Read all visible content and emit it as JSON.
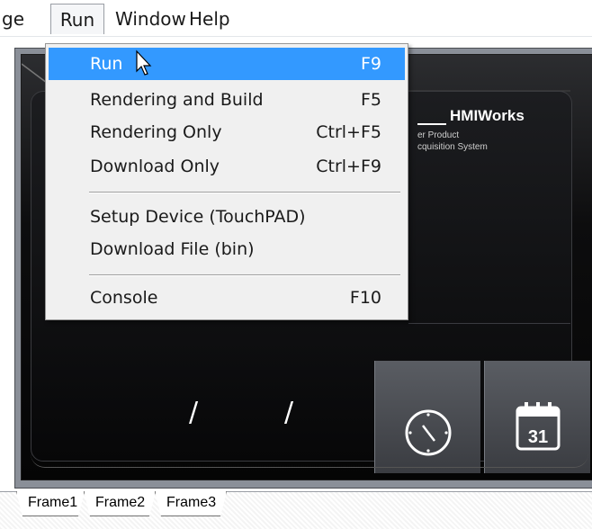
{
  "menubar": {
    "items": [
      "ge",
      "Run",
      "Window",
      "Help"
    ]
  },
  "run_menu": {
    "items": [
      {
        "label": "Run",
        "shortcut": "F9"
      },
      {
        "label": "Rendering and Build",
        "shortcut": "F5"
      },
      {
        "label": "Rendering Only",
        "shortcut": "Ctrl+F5"
      },
      {
        "label": "Download Only",
        "shortcut": "Ctrl+F9"
      },
      {
        "label": "Setup Device (TouchPAD)",
        "shortcut": ""
      },
      {
        "label": "Download File (bin)",
        "shortcut": ""
      },
      {
        "label": "Console",
        "shortcut": "F10"
      }
    ]
  },
  "device": {
    "brand_title": "HMIWorks",
    "brand_sub1": "er Product",
    "brand_sub2": "cquisition System",
    "date_sep1": "/",
    "date_sep2": "/",
    "calendar_day": "31",
    "clock_icon": "clock-icon",
    "calendar_icon": "calendar-icon"
  },
  "tabs": [
    "Frame1",
    "Frame2",
    "Frame3"
  ],
  "colors": {
    "highlight": "#3399ff",
    "menu_bg": "#f0f0f0",
    "screen_bg": "#050505"
  }
}
